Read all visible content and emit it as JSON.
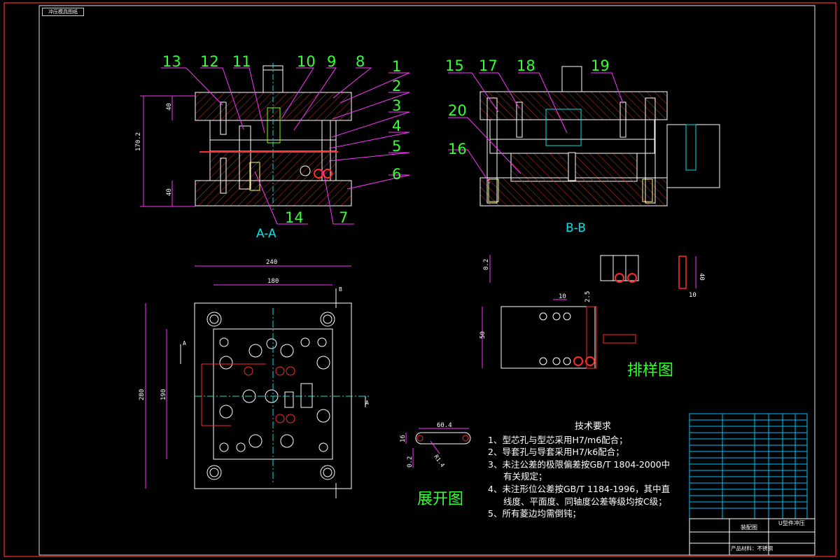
{
  "drawing": {
    "stamp_text": "冲压模具图纸",
    "section_aa_label": "A-A",
    "section_bb_label": "B-B",
    "layout_label": "排样图",
    "unfold_label": "展开图",
    "part_numbers_aa": [
      "13",
      "12",
      "11",
      "10",
      "9",
      "8",
      "1",
      "2",
      "3",
      "4",
      "5",
      "6",
      "14",
      "7"
    ],
    "part_numbers_bb": [
      "15",
      "17",
      "18",
      "19",
      "20",
      "16"
    ],
    "dimensions": {
      "overall_height": "170.2",
      "upper_plate": "40",
      "lower_plate": "40",
      "plan_width": "240",
      "plan_inner_width": "180",
      "plan_height": "280",
      "plan_inner_height": "190",
      "strip_thickness": "0.2",
      "part_height": "40",
      "part_width": "10",
      "pitch": "10",
      "edge": "2.5",
      "strip_width": "50",
      "unfold_length": "60.4",
      "unfold_height": "16",
      "unfold_radius": "R1.4",
      "unfold_thickness": "0.2"
    },
    "section_marks": [
      "A",
      "A",
      "B"
    ]
  },
  "tech_requirements": {
    "title": "技术要求",
    "items": [
      "1、型芯孔与型芯采用H7/m6配合；",
      "2、导套孔与导套采用H7/k6配合；",
      "3、未注公差的极限偏差按GB/T 1804-2000中",
      "有关规定；",
      "4、未注形位公差按GB/T 1184-1996，其中直",
      "线度、平面度、同轴度公差等级均按C级；",
      "5、所有菱边均需倒钝；"
    ]
  },
  "title_block": {
    "drawing_name": "装配图",
    "product_name": "U型件冲压",
    "material_note": "产品材料：不锈钢"
  },
  "colors": {
    "background": "#000000",
    "border": "#ff2a2a",
    "outline": "#ffffff",
    "leader": "#ff33ff",
    "label": "#33ff33",
    "center": "#00e5e5",
    "hidden": "#ffff33",
    "hatch": "#c0392b"
  }
}
